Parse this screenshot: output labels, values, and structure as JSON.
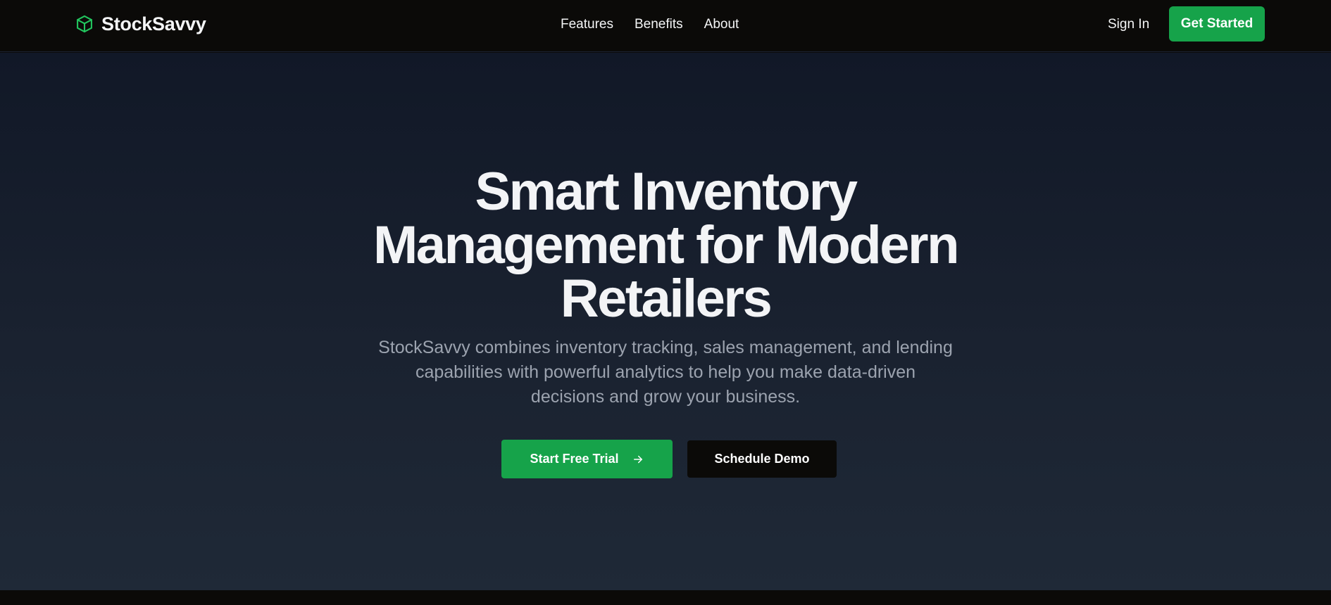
{
  "header": {
    "brand": {
      "name": "StockSavvy",
      "icon": "box-icon"
    },
    "nav": [
      {
        "label": "Features"
      },
      {
        "label": "Benefits"
      },
      {
        "label": "About"
      }
    ],
    "sign_in_label": "Sign In",
    "get_started_label": "Get Started"
  },
  "hero": {
    "title_lines": [
      "Smart Inventory",
      "Management for Modern",
      "Retailers"
    ],
    "subtitle_lines": [
      "StockSavvy combines inventory tracking, sales management, and lending",
      "capabilities with powerful analytics to help you make data-driven",
      "decisions and grow your business."
    ],
    "primary_cta": {
      "label": "Start Free Trial",
      "icon": "arrow-right-icon"
    },
    "secondary_cta": {
      "label": "Schedule Demo"
    }
  },
  "colors": {
    "accent": "#16a34a",
    "header_bg": "#0b0a08",
    "hero_bg_top": "#111827",
    "hero_bg_bottom": "#1f2937",
    "subtitle_text": "#9ca3af"
  }
}
